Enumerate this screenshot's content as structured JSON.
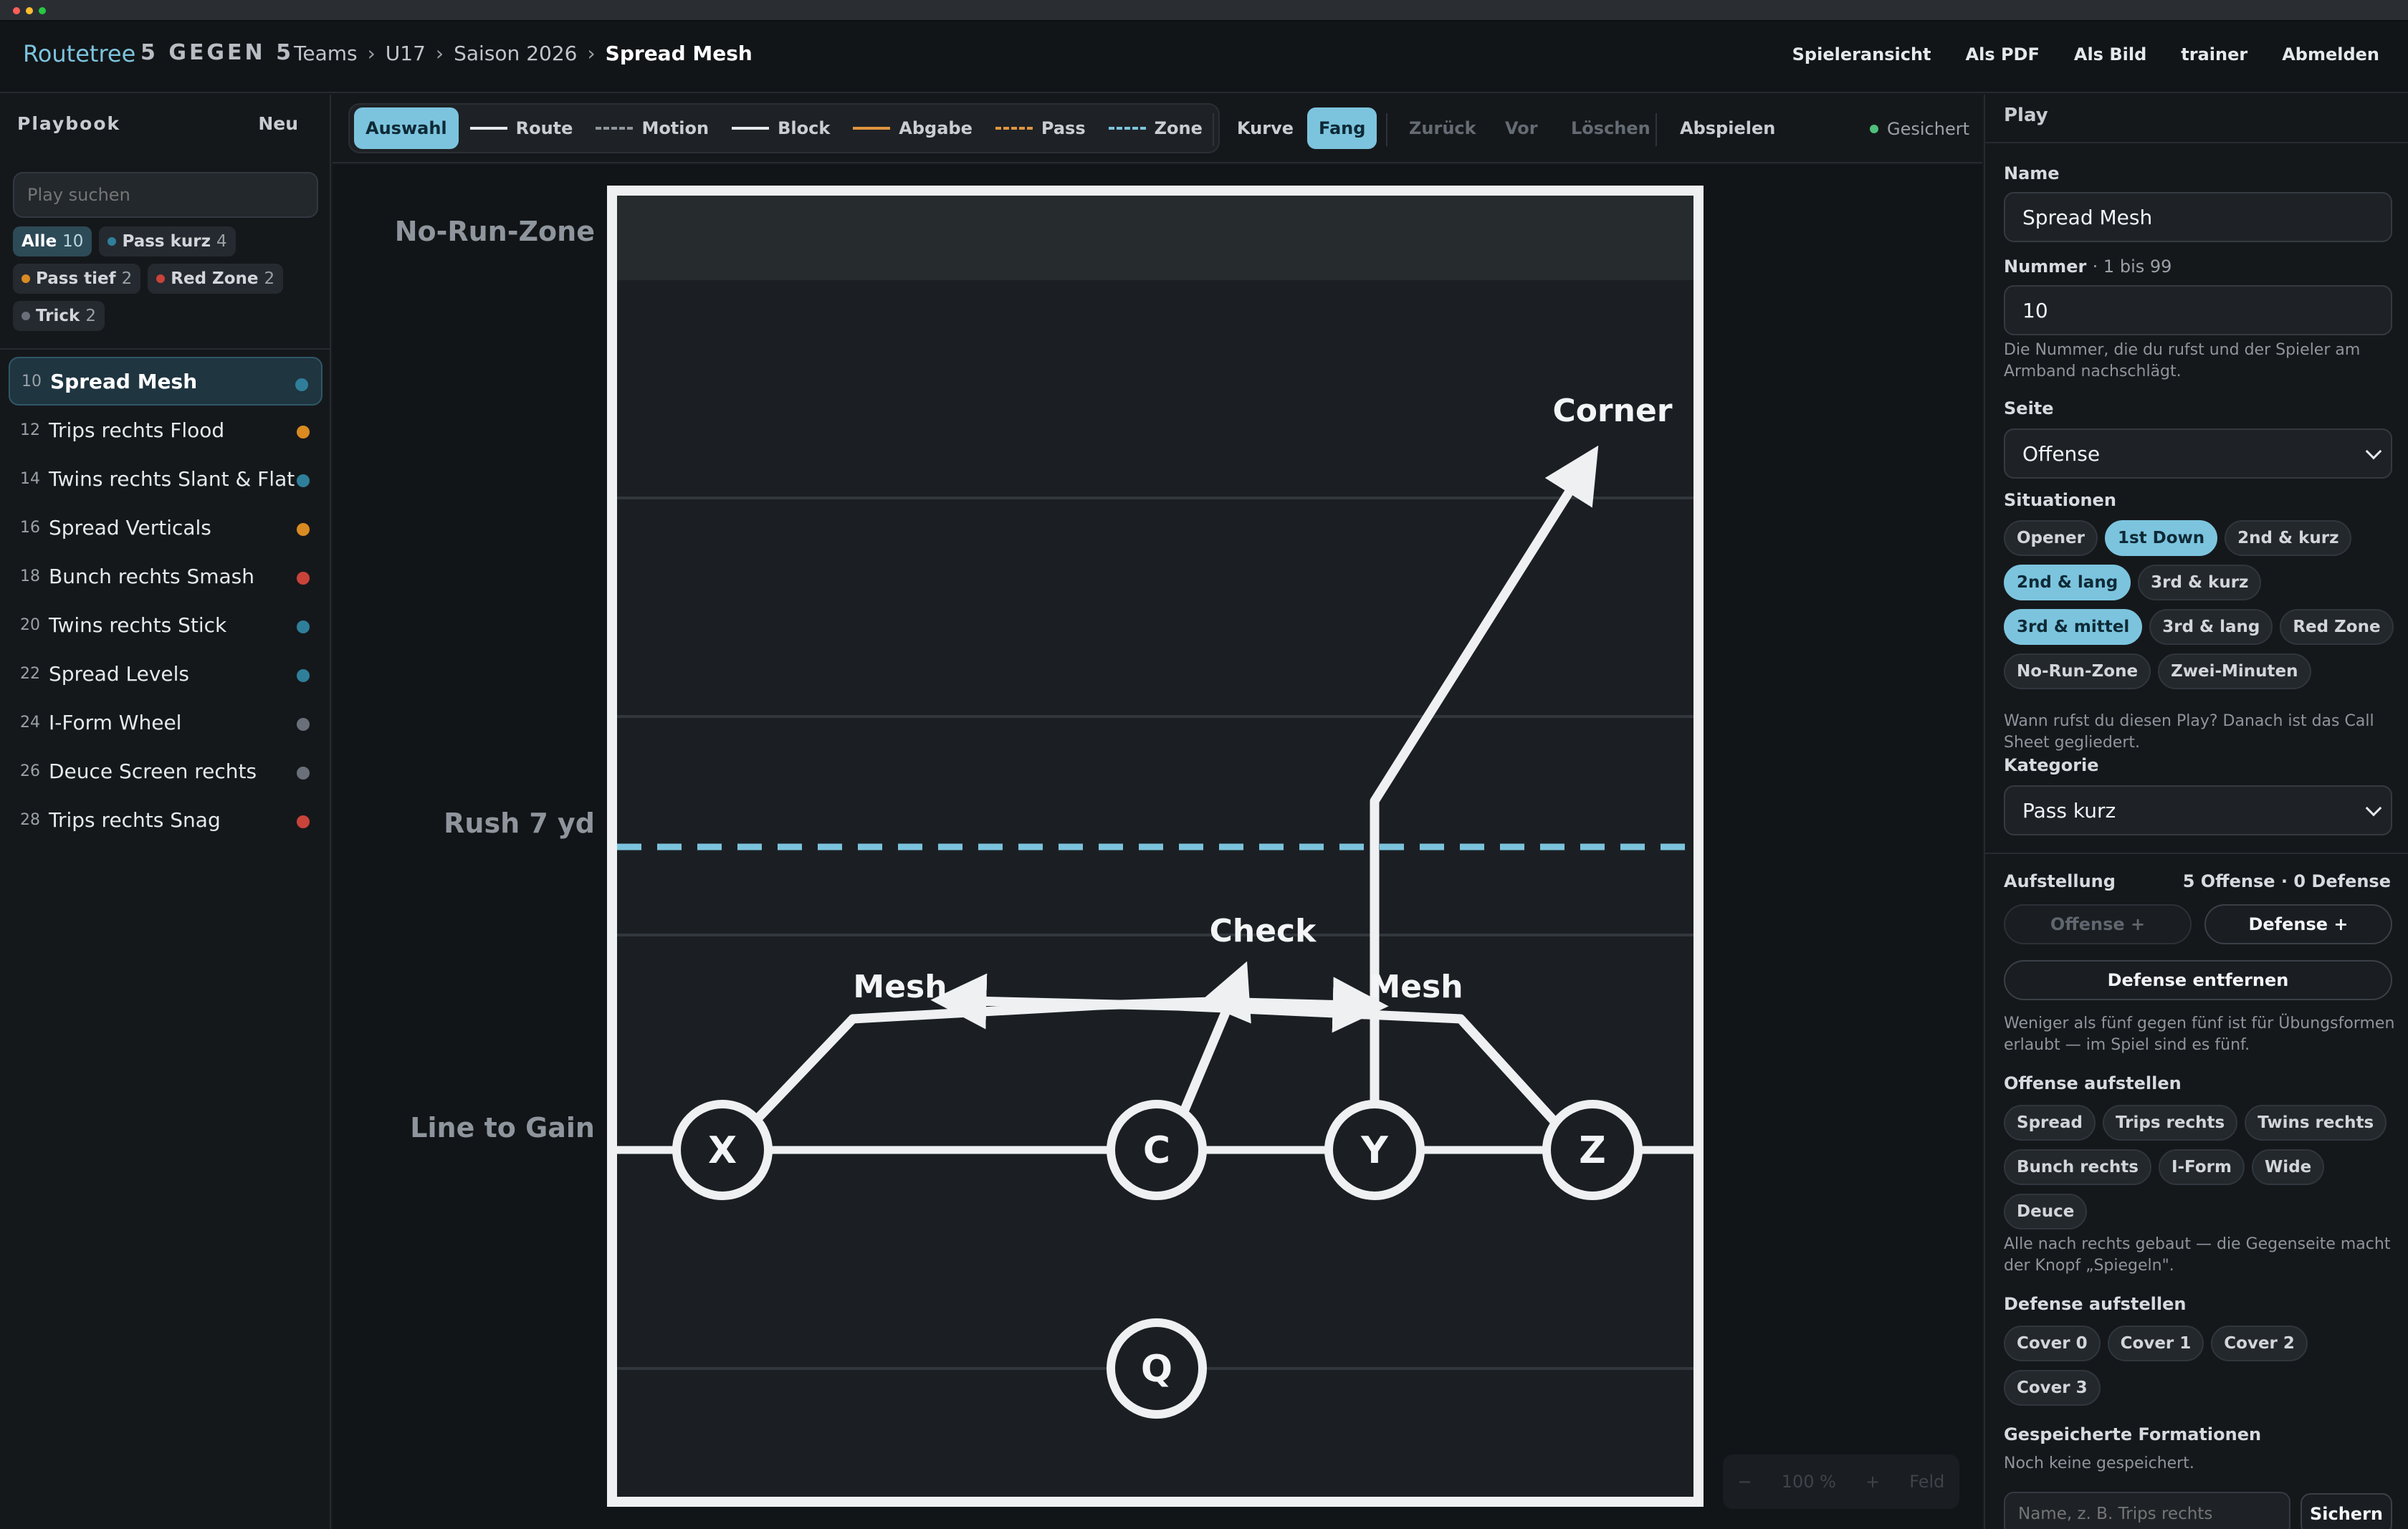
{
  "header": {
    "brand": "Routetree",
    "brand_sub": "5 GEGEN 5",
    "breadcrumb": [
      "Teams",
      "U17",
      "Saison 2026",
      "Spread Mesh"
    ],
    "breadcrumb_sep": "›",
    "nav": [
      "Spieleransicht",
      "Als PDF",
      "Als Bild",
      "trainer",
      "Abmelden"
    ]
  },
  "sidebar": {
    "title": "Playbook",
    "new_label": "Neu",
    "search_placeholder": "Play suchen",
    "filters": [
      {
        "label": "Alle",
        "count": "10",
        "color": "",
        "active": true
      },
      {
        "label": "Pass kurz",
        "count": "4",
        "color": "#2f7f9b",
        "active": false
      },
      {
        "label": "Pass tief",
        "count": "2",
        "color": "#d98b22",
        "active": false
      },
      {
        "label": "Red Zone",
        "count": "2",
        "color": "#c9433a",
        "active": false
      },
      {
        "label": "Trick",
        "count": "2",
        "color": "#6a7079",
        "active": false
      }
    ],
    "plays": [
      {
        "num": "10",
        "name": "Spread Mesh",
        "color": "#2f7f9b",
        "selected": true
      },
      {
        "num": "12",
        "name": "Trips rechts Flood",
        "color": "#d98b22"
      },
      {
        "num": "14",
        "name": "Twins rechts Slant & Flat",
        "color": "#2f7f9b"
      },
      {
        "num": "16",
        "name": "Spread Verticals",
        "color": "#d98b22"
      },
      {
        "num": "18",
        "name": "Bunch rechts Smash",
        "color": "#c9433a"
      },
      {
        "num": "20",
        "name": "Twins rechts Stick",
        "color": "#2f7f9b"
      },
      {
        "num": "22",
        "name": "Spread Levels",
        "color": "#2f7f9b"
      },
      {
        "num": "24",
        "name": "I-Form Wheel",
        "color": "#6a7079"
      },
      {
        "num": "26",
        "name": "Deuce Screen rechts",
        "color": "#6a7079"
      },
      {
        "num": "28",
        "name": "Trips rechts Snag",
        "color": "#c9433a"
      }
    ]
  },
  "toolbar": {
    "select": "Auswahl",
    "route": "Route",
    "motion": "Motion",
    "block": "Block",
    "handoff": "Abgabe",
    "pass": "Pass",
    "zone": "Zone",
    "curve": "Kurve",
    "catch": "Fang",
    "undo": "Zurück",
    "redo": "Vor",
    "delete": "Löschen",
    "play": "Abspielen",
    "saved": "Gesichert"
  },
  "field": {
    "no_run_zone": "No-Run-Zone",
    "rush": "Rush 7 yd",
    "line_to_gain": "Line to Gain",
    "players": [
      "X",
      "C",
      "Y",
      "Z",
      "Q"
    ],
    "route_labels": [
      "Corner",
      "Check",
      "Mesh",
      "Mesh"
    ],
    "colors": {
      "line": "#eef0f2",
      "zone": "#7cc4de",
      "field": "#1b1f23"
    }
  },
  "zoom": {
    "minus": "−",
    "level": "100 %",
    "plus": "+",
    "field": "Feld"
  },
  "panel": {
    "title": "Play",
    "name_label": "Name",
    "name_value": "Spread Mesh",
    "number_label": "Nummer",
    "number_hint": "· 1 bis 99",
    "number_value": "10",
    "number_help": "Die Nummer, die du rufst und der Spieler am Armband nachschlägt.",
    "side_label": "Seite",
    "side_value": "Offense",
    "situations_label": "Situationen",
    "situations": [
      {
        "label": "Opener",
        "on": false
      },
      {
        "label": "1st Down",
        "on": true
      },
      {
        "label": "2nd & kurz",
        "on": false
      },
      {
        "label": "2nd & lang",
        "on": true
      },
      {
        "label": "3rd & kurz",
        "on": false
      },
      {
        "label": "3rd & mittel",
        "on": true
      },
      {
        "label": "3rd & lang",
        "on": false
      },
      {
        "label": "Red Zone",
        "on": false
      },
      {
        "label": "No-Run-Zone",
        "on": false
      },
      {
        "label": "Zwei-Minuten",
        "on": false
      }
    ],
    "situations_help": "Wann rufst du diesen Play? Danach ist das Call Sheet gegliedert.",
    "category_label": "Kategorie",
    "category_value": "Pass kurz",
    "lineup_label": "Aufstellung",
    "lineup_count": "5 Offense · 0 Defense",
    "offense_add": "Offense +",
    "defense_add": "Defense +",
    "defense_remove": "Defense entfernen",
    "lineup_help": "Weniger als fünf gegen fünf ist für Übungsformen erlaubt — im Spiel sind es fünf.",
    "offense_setup_label": "Offense aufstellen",
    "offense_setups": [
      "Spread",
      "Trips rechts",
      "Twins rechts",
      "Bunch rechts",
      "I-Form",
      "Wide",
      "Deuce"
    ],
    "offense_help": "Alle nach rechts gebaut — die Gegenseite macht der Knopf „Spiegeln\".",
    "defense_setup_label": "Defense aufstellen",
    "defense_setups": [
      "Cover 0",
      "Cover 1",
      "Cover 2",
      "Cover 3"
    ],
    "saved_formations_label": "Gespeicherte Formationen",
    "saved_formations_empty": "Noch keine gespeichert.",
    "formation_placeholder": "Name, z. B. Trips rechts",
    "formation_save": "Sichern"
  }
}
